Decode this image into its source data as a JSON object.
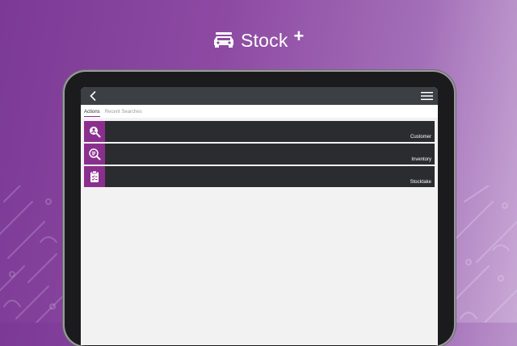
{
  "brand": {
    "name": "Stock",
    "plus": "+",
    "logo_icon": "car-icon"
  },
  "app": {
    "back_icon": "chevron-left-icon",
    "menu_icon": "hamburger-menu-icon",
    "tabs": [
      {
        "label": "Actions",
        "active": true
      },
      {
        "label": "Recent Searches",
        "active": false
      }
    ],
    "actions": [
      {
        "label": "Customer",
        "icon": "customer-search-icon"
      },
      {
        "label": "Inventory",
        "icon": "inventory-search-icon"
      },
      {
        "label": "Stocktake",
        "icon": "clipboard-icon"
      }
    ]
  },
  "colors": {
    "accent": "#8b2f8e",
    "row_bg": "#2a2c2f",
    "topbar_bg": "#3c4044",
    "screen_bg": "#f2f2f2"
  }
}
